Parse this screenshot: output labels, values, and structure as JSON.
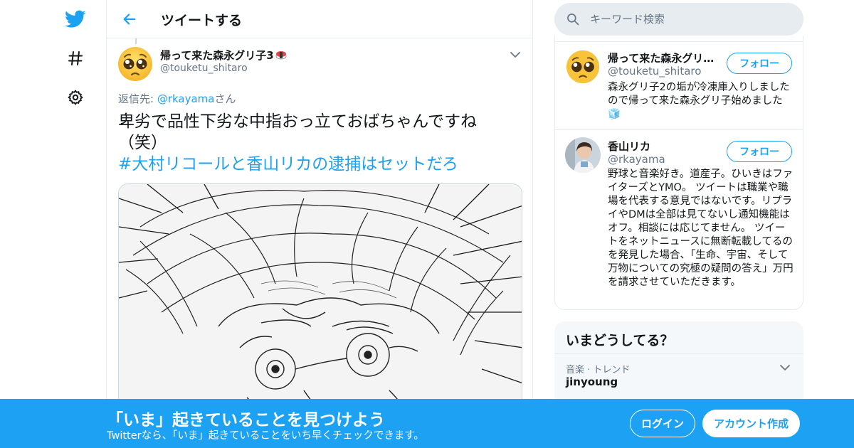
{
  "colors": {
    "accent": "#1da1f2",
    "border": "#e6ecf0",
    "muted": "#657786",
    "text": "#14171a",
    "banner": "#1da1f2"
  },
  "nav": {
    "icons": [
      "twitter-logo-icon",
      "hashtag-icon",
      "gear-icon"
    ]
  },
  "header": {
    "title": "ツイートする"
  },
  "tweet": {
    "author_name": "帰って来た森永グリ子3",
    "author_handle": "@touketu_shitaro",
    "reply_prefix": "返信先: ",
    "reply_mention": "@rkayama",
    "reply_suffix": "さん",
    "text": "卑劣で品性下劣な中指おっ立ておばちゃんですね（笑）",
    "hashtag": "#大村リコールと香山リカの逮捕はセットだろ"
  },
  "search": {
    "placeholder": "キーワード検索"
  },
  "users": [
    {
      "name": "帰って来た森永グリ子3🍣",
      "name_display": "帰って来た森永グリ…",
      "handle": "@touketu_shitaro",
      "follow_label": "フォロー",
      "bio": "森永グリ子2の垢が冷凍庫入りしましたので帰って来た森永グリ子始めました🧊"
    },
    {
      "name": "香山リカ",
      "handle": "@rkayama",
      "follow_label": "フォロー",
      "bio": "野球と音楽好き。道産子。ひいきはファイターズとYMO。 ツイートは職業や職場を代表する意見ではないです。リプライやDMは全部は見てないし通知機能はオフ。相談には応じてません。 ツイートをネットニュースに無断転載してるのを発見した場合、「生命、宇宙、そして万物についての究極の疑問の答え」万円を請求させていただきます。"
    }
  ],
  "trends": {
    "title": "いまどうしてる？",
    "items": [
      {
        "meta": "音楽 · トレンド",
        "name": "jinyoung",
        "count": ""
      }
    ]
  },
  "banner": {
    "title": "「いま」起きていることを見つけよう",
    "subtitle": "Twitterなら、「いま」起きていることをいち早くチェックできます。",
    "login_label": "ログイン",
    "signup_label": "アカウント作成"
  }
}
